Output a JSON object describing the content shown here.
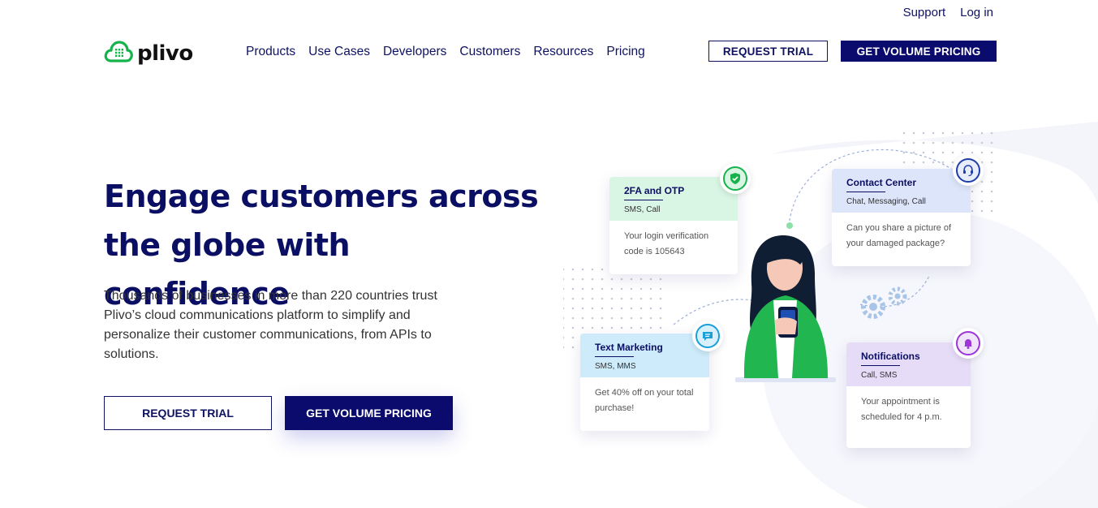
{
  "topbar": {
    "support": "Support",
    "login": "Log in"
  },
  "brand": {
    "name": "plivo",
    "color": "#16b24b"
  },
  "nav": [
    {
      "label": "Products"
    },
    {
      "label": "Use Cases"
    },
    {
      "label": "Developers"
    },
    {
      "label": "Customers"
    },
    {
      "label": "Resources"
    },
    {
      "label": "Pricing"
    }
  ],
  "header_buttons": {
    "request_trial": "REQUEST TRIAL",
    "volume_pricing": "GET VOLUME PRICING"
  },
  "hero": {
    "title": "Engage customers across the globe with confidence",
    "description": "Thousands of businesses in more than 220 countries trust Plivo’s cloud communications platform to simplify and personalize their customer communications, from APIs to solutions.",
    "request_trial": "REQUEST TRIAL",
    "volume_pricing": "GET VOLUME PRICING"
  },
  "cards": {
    "otp": {
      "title": "2FA and OTP",
      "channels": "SMS, Call",
      "message": "Your login verification code is 105643",
      "color": "#d9f5e3"
    },
    "contact": {
      "title": "Contact Center",
      "channels": "Chat, Messaging, Call",
      "message": "Can you share a picture of your damaged package?",
      "color": "#dde5fb"
    },
    "marketing": {
      "title": "Text Marketing",
      "channels": "SMS, MMS",
      "message": "Get 40% off on your total purchase!",
      "color": "#cdebfa"
    },
    "notifications": {
      "title": "Notifications",
      "channels": "Call, SMS",
      "message": "Your appointment is scheduled for 4 p.m.",
      "color": "#e6dcf7"
    }
  },
  "colors": {
    "primary": "#0b0b6e",
    "accent_green": "#16b24b"
  },
  "icons": [
    "cloud-logo-icon",
    "shield-check-icon",
    "headset-icon",
    "chat-bubble-icon",
    "bell-icon",
    "gear-icon",
    "play-icon"
  ]
}
